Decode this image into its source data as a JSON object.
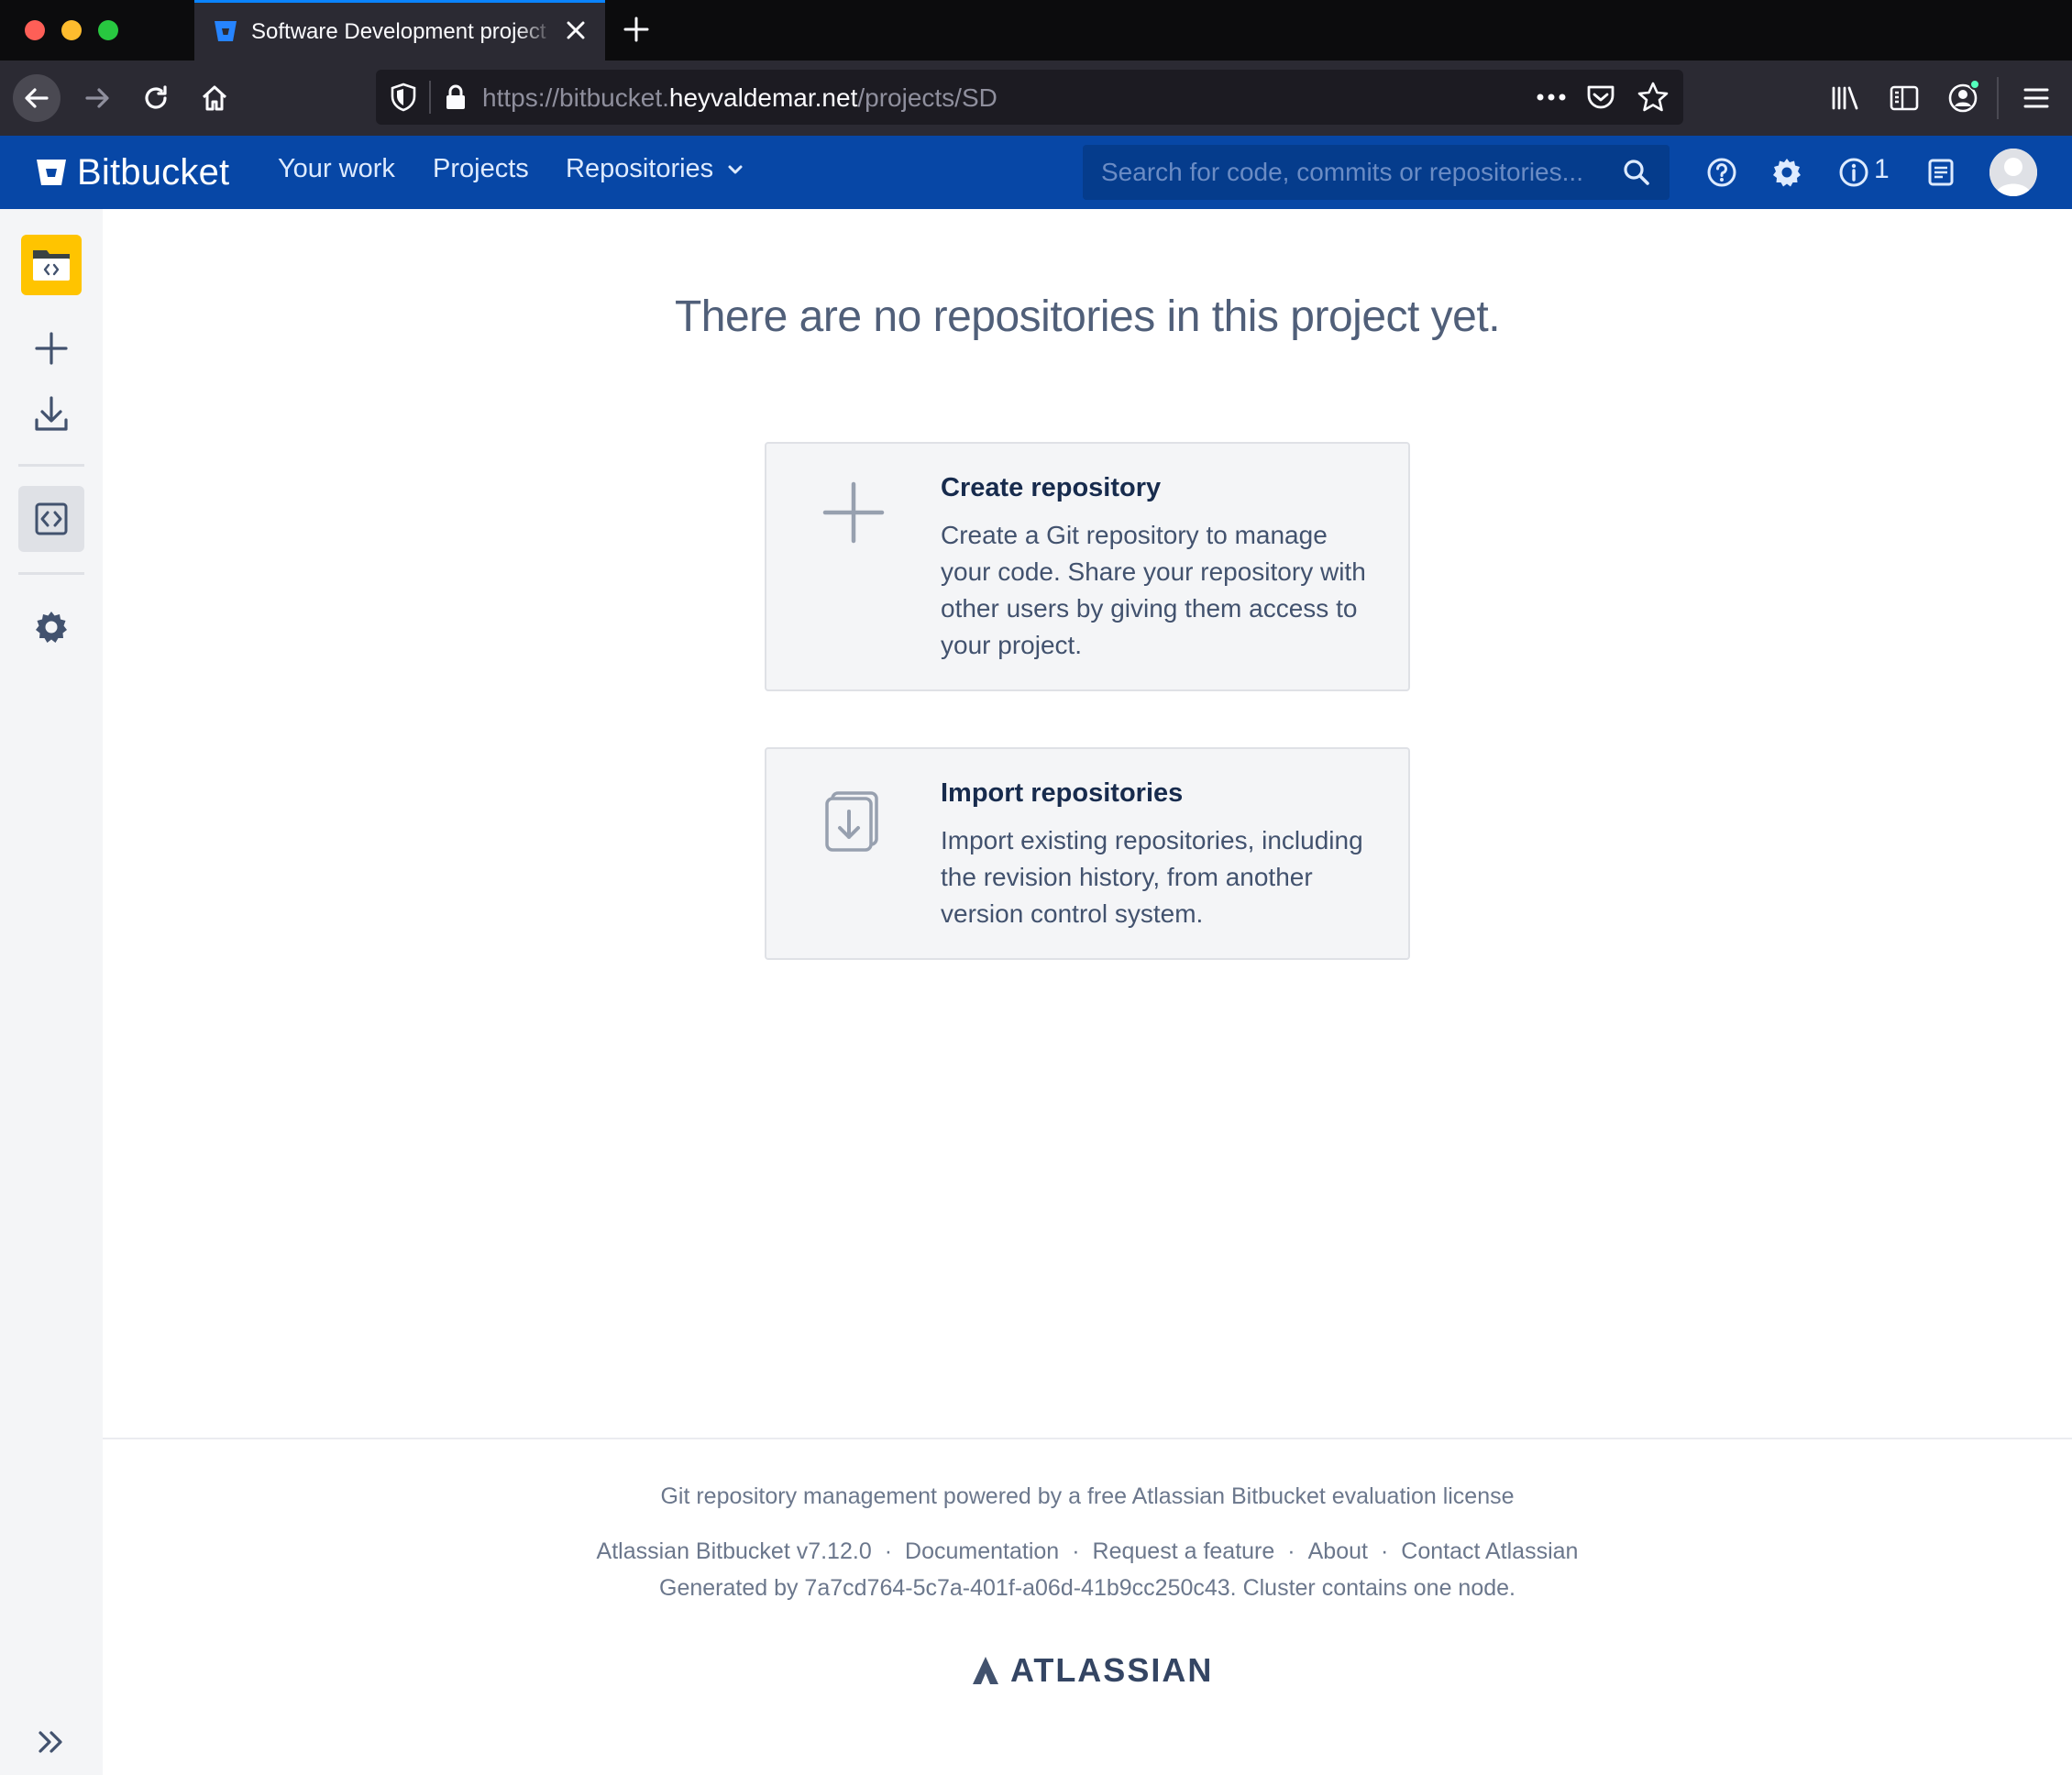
{
  "browser": {
    "tab_title": "Software Development project",
    "url_prefix": "https://bitbucket.",
    "url_host": "heyvaldemar.net",
    "url_path": "/projects/SD"
  },
  "header": {
    "brand": "Bitbucket",
    "nav": {
      "your_work": "Your work",
      "projects": "Projects",
      "repositories": "Repositories"
    },
    "search_placeholder": "Search for code, commits or repositories...",
    "info_count": "1"
  },
  "main": {
    "title": "There are no repositories in this project yet.",
    "cards": [
      {
        "title": "Create repository",
        "description": "Create a Git repository to manage your code. Share your repository with other users by giving them access to your project.",
        "icon": "plus-icon"
      },
      {
        "title": "Import repositories",
        "description": "Import existing repositories, including the revision history, from another version control system.",
        "icon": "import-icon"
      }
    ]
  },
  "footer": {
    "license": "Git repository management powered by a free Atlassian Bitbucket evaluation license",
    "links": [
      "Atlassian Bitbucket v7.12.0",
      "Documentation",
      "Request a feature",
      "About",
      "Contact Atlassian"
    ],
    "separator": "·",
    "generated": "Generated by 7a7cd764-5c7a-401f-a06d-41b9cc250c43. Cluster contains one node.",
    "atlassian": "ATLASSIAN"
  },
  "colors": {
    "header_bg": "#0747a6",
    "project_avatar": "#ffc400",
    "sidebar_bg": "#f4f5f7"
  }
}
